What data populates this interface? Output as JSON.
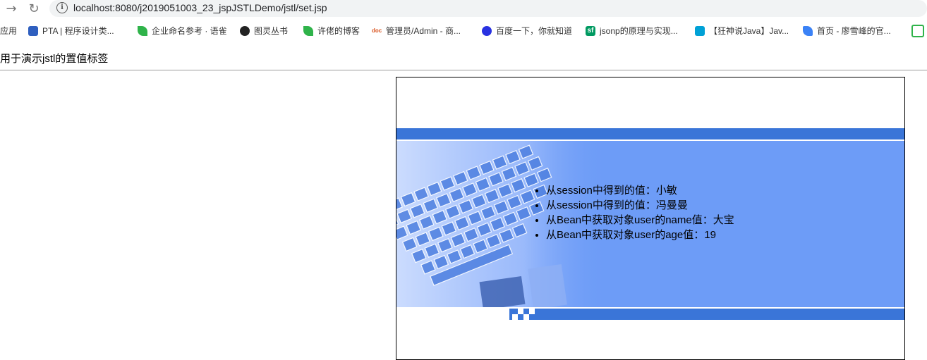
{
  "browser": {
    "url": "localhost:8080/j2019051003_23_jspJSTLDemo/jstl/set.jsp",
    "info_glyph": "i"
  },
  "bookmarks": [
    {
      "label": "应用",
      "icon": "apps-icon",
      "color": "#4285f4"
    },
    {
      "label": "PTA | 程序设计类...",
      "icon": "pta-icon",
      "color": "#2f5fbf"
    },
    {
      "label": "企业命名参考 · 语雀",
      "icon": "yuque-icon",
      "color": "#2fb34a"
    },
    {
      "label": "图灵丛书",
      "icon": "github-icon",
      "color": "#222222"
    },
    {
      "label": "许佬的博客",
      "icon": "yuque-icon",
      "color": "#2fb34a"
    },
    {
      "label": "管理员/Admin - 商...",
      "icon": "doc-icon",
      "color": "#d9531e"
    },
    {
      "label": "百度一下，你就知道",
      "icon": "baidu-icon",
      "color": "#2932e1"
    },
    {
      "label": "jsonp的原理与实现...",
      "icon": "sf-icon",
      "color": "#009a61"
    },
    {
      "label": "【狂神说Java】Jav...",
      "icon": "bilibili-icon",
      "color": "#00a1d6"
    },
    {
      "label": "首页 - 廖雪峰的官...",
      "icon": "rocket-icon",
      "color": "#3b82f6"
    }
  ],
  "page": {
    "heading": "用于演示jstl的置值标签",
    "items": [
      "从session中得到的值：小敏",
      "从session中得到的值：冯曼曼",
      "从Bean中获取对象user的name值：大宝",
      "从Bean中获取对象user的age值：19"
    ]
  },
  "colors": {
    "band_dark": "#3a75d8",
    "band_light": "#6d9cf7"
  }
}
